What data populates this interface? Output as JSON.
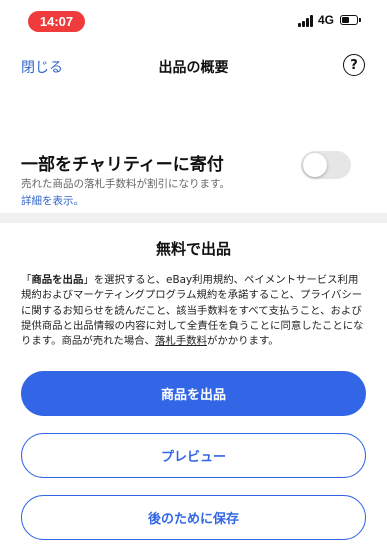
{
  "status_bar": {
    "time": "14:07",
    "network": "4G",
    "signal_icon": "cellular-signal-icon",
    "battery_icon": "battery-icon"
  },
  "header": {
    "close_label": "閉じる",
    "title": "出品の概要",
    "help_icon": "help-icon",
    "help_glyph": "?"
  },
  "charity": {
    "title": "一部をチャリティーに寄付",
    "subtitle": "売れた商品の落札手数料が割引になります。",
    "details_link": "詳細を表示。",
    "toggle_on": false
  },
  "free_listing": {
    "title": "無料で出品",
    "legal_pre": "「",
    "legal_bold": "商品を出品",
    "legal_mid": "」を選択すると、eBay利用規約、ペイメントサービス利用規約およびマーケティングプログラム規約を承諾すること、プライバシーに関するお知らせを読んだこと、該当手数料をすべて支払うこと、および提供商品と出品情報の内容に対して全責任を負うことに同意したことになります。商品が売れた場合、",
    "legal_link": "落札手数料",
    "legal_post": "がかかります。"
  },
  "actions": {
    "list_item": "商品を出品",
    "preview": "プレビュー",
    "save_for_later": "後のために保存"
  },
  "colors": {
    "accent": "#3366e6",
    "link": "#3366cc",
    "time_pill": "#ef3b3b"
  }
}
